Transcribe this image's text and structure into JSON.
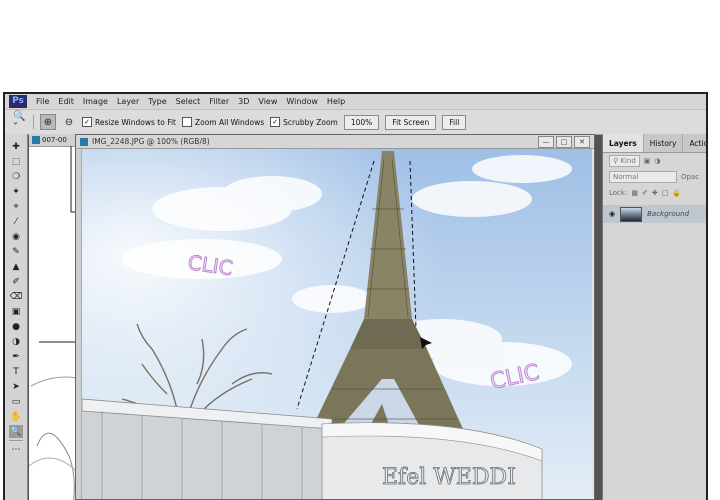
{
  "app": {
    "logo": "Ps",
    "menu": [
      "File",
      "Edit",
      "Image",
      "Layer",
      "Type",
      "Select",
      "Filter",
      "3D",
      "View",
      "Window",
      "Help"
    ]
  },
  "options": {
    "resize_windows": "Resize Windows to Fit",
    "zoom_all": "Zoom All Windows",
    "scrubby_zoom": "Scrubby Zoom",
    "zoom_value": "100%",
    "fit_screen": "Fit Screen",
    "fill": "Fill"
  },
  "documents": {
    "back_tab": "007-00",
    "front_title": "IMG_2248.JPG @ 100% (RGB/8)"
  },
  "image": {
    "clic_left": "CLIC",
    "clic_right": "CLIC",
    "sign": "Efel WEDDI"
  },
  "panels": {
    "tabs": [
      "Layers",
      "History",
      "Actions"
    ],
    "kind": "Kind",
    "blend": "Normal",
    "opacity": "Opac",
    "lock": "Lock:",
    "layer_name": "Background"
  },
  "colors": {
    "sky": "#a9c6e6",
    "chrome": "#d6d6d6",
    "workspace": "#535353",
    "clic_text": "#f3d6f7"
  }
}
